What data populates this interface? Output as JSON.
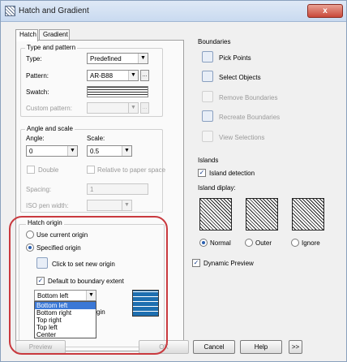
{
  "window": {
    "title": "Hatch and Gradient",
    "close_glyph": "x"
  },
  "tabs": [
    {
      "label": "Hatch"
    },
    {
      "label": "Gradient"
    }
  ],
  "type_pattern": {
    "group_label": "Type and pattern",
    "type_label": "Type:",
    "type_value": "Predefined",
    "pattern_label": "Pattern:",
    "pattern_value": "AR-B88",
    "swatch_label": "Swatch:",
    "custom_label": "Custom pattern:"
  },
  "angle_scale": {
    "group_label": "Angle and scale",
    "angle_label": "Angle:",
    "angle_value": "0",
    "scale_label": "Scale:",
    "scale_value": "0.5",
    "double_label": "Double",
    "relative_label": "Relative to paper space",
    "spacing_label": "Spacing:",
    "spacing_value": "1",
    "iso_label": "ISO pen width:"
  },
  "hatch_origin": {
    "group_label": "Hatch origin",
    "use_current": "Use current origin",
    "specified": "Specified origin",
    "click_set": "Click to set new origin",
    "default_boundary": "Default to boundary extent",
    "position_value": "Bottom left",
    "store_label": "gin",
    "options": [
      "Bottom left",
      "Bottom right",
      "Top right",
      "Top left",
      "Center"
    ]
  },
  "boundaries": {
    "group_label": "Boundaries",
    "pick_points": "Pick Points",
    "select_objects": "Select Objects",
    "remove": "Remove Boundaries",
    "recreate": "Recreate Boundaries",
    "view": "View Selections"
  },
  "islands": {
    "group_label": "Islands",
    "detection": "Island detection",
    "display_label": "Island diplay:",
    "normal": "Normal",
    "outer": "Outer",
    "ignore": "Ignore"
  },
  "dynamic_preview": "Dynamic Preview",
  "buttons": {
    "preview": "Preview",
    "ok": "OK",
    "cancel": "Cancel",
    "help": "Help",
    "more": ">>"
  },
  "icons": {
    "check": "✓",
    "dots": "...",
    "arrow_down": "▼"
  }
}
